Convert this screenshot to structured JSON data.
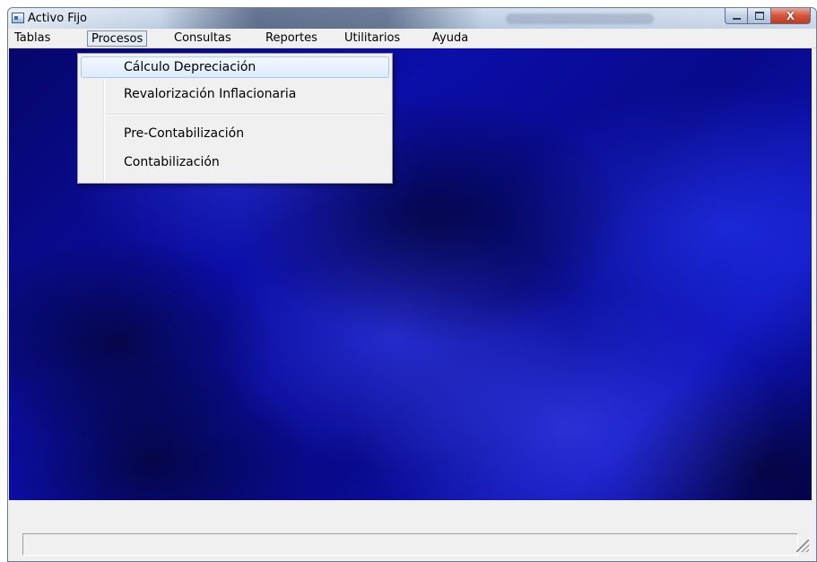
{
  "window": {
    "title": "Activo Fijo",
    "icon": "app-window-icon",
    "buttons": {
      "minimize_icon": "minimize-icon",
      "maximize_icon": "maximize-icon",
      "close_label": "X"
    }
  },
  "menubar": {
    "items": [
      {
        "label": "Tablas"
      },
      {
        "label": "Procesos",
        "open": true
      },
      {
        "label": "Consultas"
      },
      {
        "label": "Reportes"
      },
      {
        "label": "Utilitarios"
      },
      {
        "label": "Ayuda"
      }
    ]
  },
  "procesos_menu": {
    "items": [
      {
        "label": "Cálculo Depreciación",
        "highlighted": true
      },
      {
        "label": "Revalorización Inflacionaria"
      },
      {
        "label": "Pre-Contabilización"
      },
      {
        "label": "Contabilización"
      }
    ]
  },
  "statusbar": {
    "text": "",
    "grip_icon": "resize-grip-icon"
  },
  "colors": {
    "menu_highlight": "#dcebfc",
    "desktop_blue": "#0b0ea8",
    "close_button": "#c2391f"
  }
}
